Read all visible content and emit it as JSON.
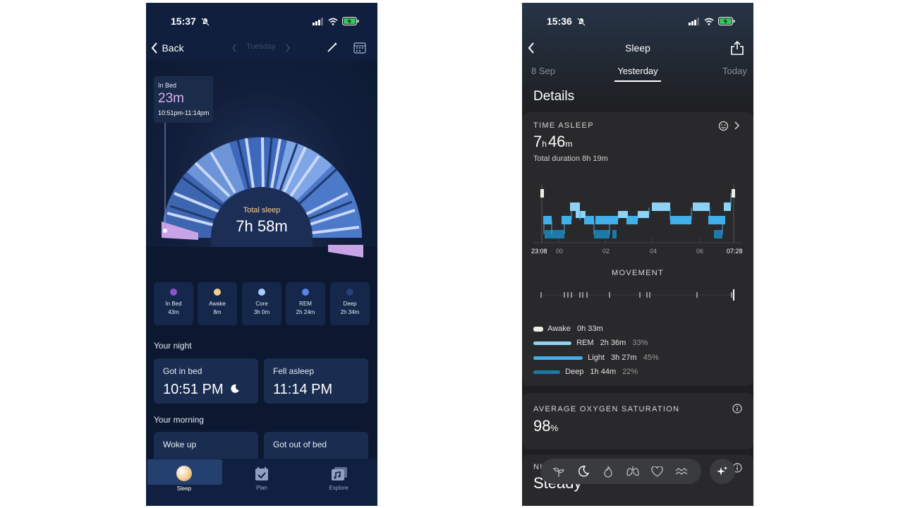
{
  "left": {
    "status_time": "15:37",
    "back_label": "Back",
    "day_label": "Tuesday",
    "in_bed_card": {
      "title": "In Bed",
      "value": "23m",
      "range": "10:51pm-11:14pm"
    },
    "total_sleep": {
      "label": "Total sleep",
      "value": "7h 58m"
    },
    "legend": [
      {
        "label": "In Bed",
        "value": "43m",
        "color": "#8e52c8"
      },
      {
        "label": "Awake",
        "value": "8m",
        "color": "#f2cf8e"
      },
      {
        "label": "Core",
        "value": "3h 0m",
        "color": "#a9c9ff"
      },
      {
        "label": "REM",
        "value": "2h 24m",
        "color": "#5b83e6"
      },
      {
        "label": "Deep",
        "value": "2h 34m",
        "color": "#27447a"
      }
    ],
    "your_night_label": "Your night",
    "got_in_bed": {
      "label": "Got in bed",
      "value": "10:51 PM"
    },
    "fell_asleep": {
      "label": "Fell asleep",
      "value": "11:14 PM"
    },
    "your_morning_label": "Your morning",
    "woke_up": {
      "label": "Woke up"
    },
    "got_out_of_bed": {
      "label": "Got out of bed"
    },
    "tabs": {
      "sleep": "Sleep",
      "plan": "Plan",
      "explore": "Explore"
    }
  },
  "right": {
    "status_time": "15:36",
    "title": "Sleep",
    "date_prev": "8 Sep",
    "date_current": "Yesterday",
    "date_next": "Today",
    "details_title": "Details",
    "time_asleep": {
      "label": "TIME ASLEEP",
      "hours": "7",
      "h_unit": "h",
      "minutes": "46",
      "m_unit": "m",
      "total": "Total duration 8h 19m"
    },
    "x_labels": [
      "23:08",
      "00",
      "02",
      "04",
      "06",
      "07:28"
    ],
    "movement_label": "MOVEMENT",
    "stages": [
      {
        "name": "Awake",
        "value": "0h 33m",
        "pct": "",
        "color": "#f1ede6"
      },
      {
        "name": "REM",
        "value": "2h 36m",
        "pct": "33%",
        "color": "#8ed3f6"
      },
      {
        "name": "Light",
        "value": "3h 27m",
        "pct": "45%",
        "color": "#41b0ea"
      },
      {
        "name": "Deep",
        "value": "1h 44m",
        "pct": "22%",
        "color": "#1b7aa8"
      }
    ],
    "oxygen": {
      "label": "AVERAGE OXYGEN SATURATION",
      "value": "98",
      "unit": "%"
    },
    "next_card": {
      "label": "NI",
      "value": "Steady"
    }
  }
}
